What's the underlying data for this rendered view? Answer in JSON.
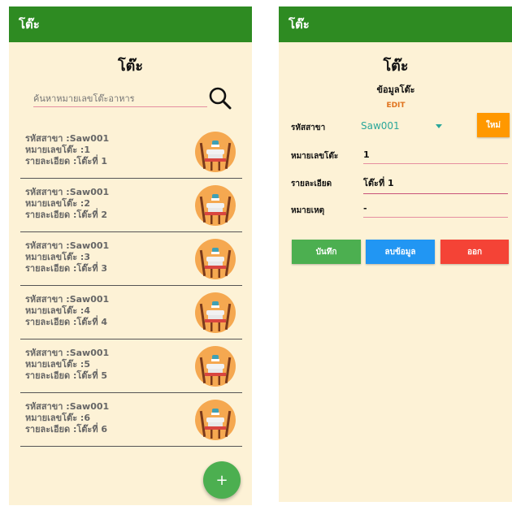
{
  "left_screen": {
    "appbar_title": "โต๊ะ",
    "page_title": "โต๊ะ",
    "search": {
      "placeholder": "ค้นหาหมายเลขโต๊ะอาหาร",
      "value": ""
    },
    "items": [
      {
        "branch": "รหัสสาขา :Saw001",
        "number": "หมายเลขโต๊ะ :1",
        "detail": "รายละเอียด :โต๊ะที่ 1"
      },
      {
        "branch": "รหัสสาขา :Saw001",
        "number": "หมายเลขโต๊ะ :2",
        "detail": "รายละเอียด :โต๊ะที่ 2"
      },
      {
        "branch": "รหัสสาขา :Saw001",
        "number": "หมายเลขโต๊ะ :3",
        "detail": "รายละเอียด :โต๊ะที่ 3"
      },
      {
        "branch": "รหัสสาขา :Saw001",
        "number": "หมายเลขโต๊ะ :4",
        "detail": "รายละเอียด :โต๊ะที่ 4"
      },
      {
        "branch": "รหัสสาขา :Saw001",
        "number": "หมายเลขโต๊ะ :5",
        "detail": "รายละเอียด :โต๊ะที่ 5"
      },
      {
        "branch": "รหัสสาขา :Saw001",
        "number": "หมายเลขโต๊ะ :6",
        "detail": "รายละเอียด :โต๊ะที่ 6"
      }
    ],
    "fab_label": "+"
  },
  "right_screen": {
    "appbar_title": "โต๊ะ",
    "page_title": "โต๊ะ",
    "subtitle": "ข้อมูลโต๊ะ",
    "mode": "EDIT",
    "fields": {
      "branch_label": "รหัสสาขา",
      "branch_value": "Saw001",
      "new_button": "ใหม่",
      "table_no_label": "หมายเลขโต๊ะ",
      "table_no_value": "1",
      "detail_label": "รายละเอียด",
      "detail_value": "โต๊ะที่ 1",
      "note_label": "หมายเหตุ",
      "note_value": "-"
    },
    "buttons": {
      "save": "บันทึก",
      "delete": "ลบข้อมูล",
      "exit": "ออก"
    }
  },
  "colors": {
    "appbar": "#2e8b22",
    "background": "#fdf2d6",
    "save": "#4caf50",
    "delete": "#2196f3",
    "exit": "#f44336",
    "new": "#ff9800",
    "dropdown_text": "#2aa79a",
    "underline": "#e58ea0"
  },
  "icons": [
    "search-icon",
    "table-chairs-icon",
    "dropdown-arrow-icon",
    "plus-icon"
  ]
}
